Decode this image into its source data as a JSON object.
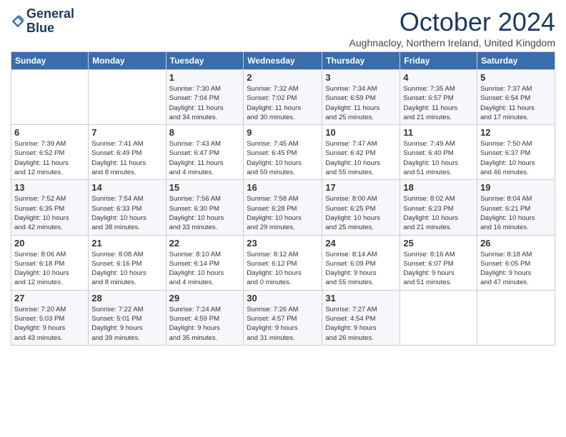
{
  "header": {
    "logo_line1": "General",
    "logo_line2": "Blue",
    "title": "October 2024",
    "subtitle": "Aughnacloy, Northern Ireland, United Kingdom"
  },
  "days_of_week": [
    "Sunday",
    "Monday",
    "Tuesday",
    "Wednesday",
    "Thursday",
    "Friday",
    "Saturday"
  ],
  "weeks": [
    [
      {
        "day": "",
        "info": ""
      },
      {
        "day": "",
        "info": ""
      },
      {
        "day": "1",
        "info": "Sunrise: 7:30 AM\nSunset: 7:04 PM\nDaylight: 11 hours\nand 34 minutes."
      },
      {
        "day": "2",
        "info": "Sunrise: 7:32 AM\nSunset: 7:02 PM\nDaylight: 11 hours\nand 30 minutes."
      },
      {
        "day": "3",
        "info": "Sunrise: 7:34 AM\nSunset: 6:59 PM\nDaylight: 11 hours\nand 25 minutes."
      },
      {
        "day": "4",
        "info": "Sunrise: 7:35 AM\nSunset: 6:57 PM\nDaylight: 11 hours\nand 21 minutes."
      },
      {
        "day": "5",
        "info": "Sunrise: 7:37 AM\nSunset: 6:54 PM\nDaylight: 11 hours\nand 17 minutes."
      }
    ],
    [
      {
        "day": "6",
        "info": "Sunrise: 7:39 AM\nSunset: 6:52 PM\nDaylight: 11 hours\nand 12 minutes."
      },
      {
        "day": "7",
        "info": "Sunrise: 7:41 AM\nSunset: 6:49 PM\nDaylight: 11 hours\nand 8 minutes."
      },
      {
        "day": "8",
        "info": "Sunrise: 7:43 AM\nSunset: 6:47 PM\nDaylight: 11 hours\nand 4 minutes."
      },
      {
        "day": "9",
        "info": "Sunrise: 7:45 AM\nSunset: 6:45 PM\nDaylight: 10 hours\nand 59 minutes."
      },
      {
        "day": "10",
        "info": "Sunrise: 7:47 AM\nSunset: 6:42 PM\nDaylight: 10 hours\nand 55 minutes."
      },
      {
        "day": "11",
        "info": "Sunrise: 7:49 AM\nSunset: 6:40 PM\nDaylight: 10 hours\nand 51 minutes."
      },
      {
        "day": "12",
        "info": "Sunrise: 7:50 AM\nSunset: 6:37 PM\nDaylight: 10 hours\nand 46 minutes."
      }
    ],
    [
      {
        "day": "13",
        "info": "Sunrise: 7:52 AM\nSunset: 6:35 PM\nDaylight: 10 hours\nand 42 minutes."
      },
      {
        "day": "14",
        "info": "Sunrise: 7:54 AM\nSunset: 6:33 PM\nDaylight: 10 hours\nand 38 minutes."
      },
      {
        "day": "15",
        "info": "Sunrise: 7:56 AM\nSunset: 6:30 PM\nDaylight: 10 hours\nand 33 minutes."
      },
      {
        "day": "16",
        "info": "Sunrise: 7:58 AM\nSunset: 6:28 PM\nDaylight: 10 hours\nand 29 minutes."
      },
      {
        "day": "17",
        "info": "Sunrise: 8:00 AM\nSunset: 6:25 PM\nDaylight: 10 hours\nand 25 minutes."
      },
      {
        "day": "18",
        "info": "Sunrise: 8:02 AM\nSunset: 6:23 PM\nDaylight: 10 hours\nand 21 minutes."
      },
      {
        "day": "19",
        "info": "Sunrise: 8:04 AM\nSunset: 6:21 PM\nDaylight: 10 hours\nand 16 minutes."
      }
    ],
    [
      {
        "day": "20",
        "info": "Sunrise: 8:06 AM\nSunset: 6:18 PM\nDaylight: 10 hours\nand 12 minutes."
      },
      {
        "day": "21",
        "info": "Sunrise: 8:08 AM\nSunset: 6:16 PM\nDaylight: 10 hours\nand 8 minutes."
      },
      {
        "day": "22",
        "info": "Sunrise: 8:10 AM\nSunset: 6:14 PM\nDaylight: 10 hours\nand 4 minutes."
      },
      {
        "day": "23",
        "info": "Sunrise: 8:12 AM\nSunset: 6:12 PM\nDaylight: 10 hours\nand 0 minutes."
      },
      {
        "day": "24",
        "info": "Sunrise: 8:14 AM\nSunset: 6:09 PM\nDaylight: 9 hours\nand 55 minutes."
      },
      {
        "day": "25",
        "info": "Sunrise: 8:16 AM\nSunset: 6:07 PM\nDaylight: 9 hours\nand 51 minutes."
      },
      {
        "day": "26",
        "info": "Sunrise: 8:18 AM\nSunset: 6:05 PM\nDaylight: 9 hours\nand 47 minutes."
      }
    ],
    [
      {
        "day": "27",
        "info": "Sunrise: 7:20 AM\nSunset: 5:03 PM\nDaylight: 9 hours\nand 43 minutes."
      },
      {
        "day": "28",
        "info": "Sunrise: 7:22 AM\nSunset: 5:01 PM\nDaylight: 9 hours\nand 39 minutes."
      },
      {
        "day": "29",
        "info": "Sunrise: 7:24 AM\nSunset: 4:59 PM\nDaylight: 9 hours\nand 35 minutes."
      },
      {
        "day": "30",
        "info": "Sunrise: 7:26 AM\nSunset: 4:57 PM\nDaylight: 9 hours\nand 31 minutes."
      },
      {
        "day": "31",
        "info": "Sunrise: 7:27 AM\nSunset: 4:54 PM\nDaylight: 9 hours\nand 26 minutes."
      },
      {
        "day": "",
        "info": ""
      },
      {
        "day": "",
        "info": ""
      }
    ]
  ]
}
